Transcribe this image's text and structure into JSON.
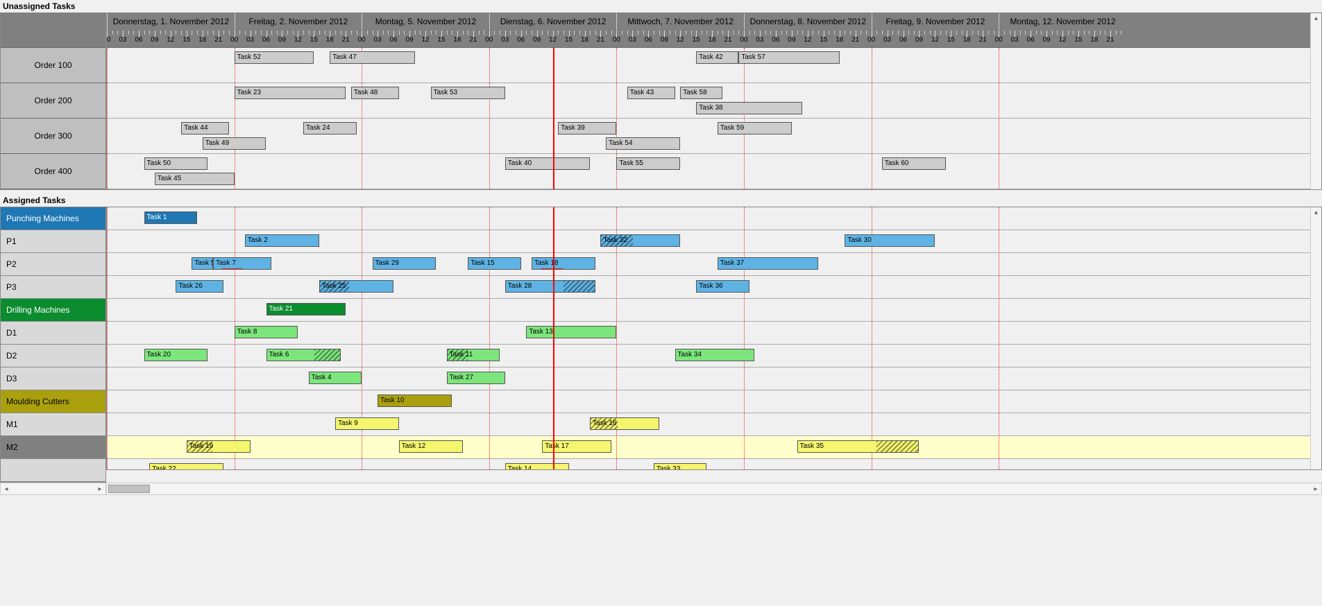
{
  "sections": {
    "unassigned": "Unassigned Tasks",
    "assigned": "Assigned Tasks"
  },
  "timeline": {
    "days": [
      "Donnerstag, 1. November 2012",
      "Freitag, 2. November 2012",
      "Montag, 5. November 2012",
      "Dienstag, 6. November 2012",
      "Mittwoch, 7. November 2012",
      "Donnerstag, 8. November 2012",
      "Freitag, 9. November 2012",
      "Montag, 12. November 2012"
    ],
    "dayStarts": [
      0,
      24,
      48,
      72,
      96,
      120,
      144,
      168
    ],
    "hours": [
      "00",
      "03",
      "06",
      "09",
      "12",
      "15",
      "18",
      "21"
    ],
    "nowHour": 84,
    "pxPerHour": 7.65
  },
  "orders": [
    "Order 100",
    "Order 200",
    "Order 300",
    "Order 400"
  ],
  "unassignedTasks": [
    {
      "row": 0,
      "sub": 0,
      "label": "Task 52",
      "start": 24,
      "dur": 15
    },
    {
      "row": 0,
      "sub": 0,
      "label": "Task 47",
      "start": 42,
      "dur": 16
    },
    {
      "row": 0,
      "sub": 0,
      "label": "Task 42",
      "start": 111,
      "dur": 8
    },
    {
      "row": 0,
      "sub": 0,
      "label": "Task 57",
      "start": 119,
      "dur": 19
    },
    {
      "row": 1,
      "sub": 0,
      "label": "Task 23",
      "start": 24,
      "dur": 21
    },
    {
      "row": 1,
      "sub": 0,
      "label": "Task 48",
      "start": 46,
      "dur": 9
    },
    {
      "row": 1,
      "sub": 0,
      "label": "Task 53",
      "start": 61,
      "dur": 14
    },
    {
      "row": 1,
      "sub": 0,
      "label": "Task 43",
      "start": 98,
      "dur": 9
    },
    {
      "row": 1,
      "sub": 0,
      "label": "Task 58",
      "start": 108,
      "dur": 8
    },
    {
      "row": 1,
      "sub": 1,
      "label": "Task 38",
      "start": 111,
      "dur": 20
    },
    {
      "row": 2,
      "sub": 0,
      "label": "Task 44",
      "start": 14,
      "dur": 9
    },
    {
      "row": 2,
      "sub": 0,
      "label": "Task 24",
      "start": 37,
      "dur": 10
    },
    {
      "row": 2,
      "sub": 0,
      "label": "Task 39",
      "start": 85,
      "dur": 11
    },
    {
      "row": 2,
      "sub": 0,
      "label": "Task 59",
      "start": 115,
      "dur": 14
    },
    {
      "row": 2,
      "sub": 1,
      "label": "Task 49",
      "start": 18,
      "dur": 12
    },
    {
      "row": 2,
      "sub": 1,
      "label": "Task 54",
      "start": 94,
      "dur": 14
    },
    {
      "row": 3,
      "sub": 0,
      "label": "Task 50",
      "start": 7,
      "dur": 12
    },
    {
      "row": 3,
      "sub": 0,
      "label": "Task 40",
      "start": 75,
      "dur": 16
    },
    {
      "row": 3,
      "sub": 0,
      "label": "Task 55",
      "start": 96,
      "dur": 12
    },
    {
      "row": 3,
      "sub": 0,
      "label": "Task 60",
      "start": 146,
      "dur": 12
    },
    {
      "row": 3,
      "sub": 1,
      "label": "Task 45",
      "start": 9,
      "dur": 15
    }
  ],
  "resources": [
    {
      "label": "Punching Machines",
      "type": "group",
      "cls": "group-punching"
    },
    {
      "label": "P1",
      "type": "res",
      "cls": "resource"
    },
    {
      "label": "P2",
      "type": "res",
      "cls": "resource"
    },
    {
      "label": "P3",
      "type": "res",
      "cls": "resource"
    },
    {
      "label": "Drilling Machines",
      "type": "group",
      "cls": "group-drilling"
    },
    {
      "label": "D1",
      "type": "res",
      "cls": "resource"
    },
    {
      "label": "D2",
      "type": "res",
      "cls": "resource"
    },
    {
      "label": "D3",
      "type": "res",
      "cls": "resource"
    },
    {
      "label": "Moulding Cutters",
      "type": "group",
      "cls": "group-moulding"
    },
    {
      "label": "M1",
      "type": "res",
      "cls": "resource"
    },
    {
      "label": "M2",
      "type": "res",
      "cls": "resource sel",
      "highlight": true
    },
    {
      "label": "",
      "type": "res",
      "cls": "resource"
    }
  ],
  "assignedTasks": [
    {
      "row": 0,
      "label": "Task 1",
      "start": 7,
      "dur": 10,
      "cls": "c-punch-dark"
    },
    {
      "row": 1,
      "label": "Task 2",
      "start": 26,
      "dur": 14,
      "cls": "c-punch"
    },
    {
      "row": 1,
      "label": "Task 32",
      "start": 93,
      "dur": 15,
      "cls": "c-punch hatch"
    },
    {
      "row": 1,
      "label": "Task 30",
      "start": 139,
      "dur": 17,
      "cls": "c-punch"
    },
    {
      "row": 2,
      "label": "Task 5",
      "start": 16,
      "dur": 4,
      "cls": "c-punch"
    },
    {
      "row": 2,
      "label": "Task 7",
      "start": 20,
      "dur": 11,
      "cls": "c-punch redmark"
    },
    {
      "row": 2,
      "label": "Task 29",
      "start": 50,
      "dur": 12,
      "cls": "c-punch"
    },
    {
      "row": 2,
      "label": "Task 15",
      "start": 68,
      "dur": 10,
      "cls": "c-punch"
    },
    {
      "row": 2,
      "label": "Task 18",
      "start": 80,
      "dur": 12,
      "cls": "c-punch redmark"
    },
    {
      "row": 2,
      "label": "Task 37",
      "start": 115,
      "dur": 19,
      "cls": "c-punch"
    },
    {
      "row": 3,
      "label": "Task 26",
      "start": 13,
      "dur": 9,
      "cls": "c-punch"
    },
    {
      "row": 3,
      "label": "Task 25",
      "start": 40,
      "dur": 14,
      "cls": "c-punch hatch"
    },
    {
      "row": 3,
      "label": "Task 28",
      "start": 75,
      "dur": 17,
      "cls": "c-punch hatch-r"
    },
    {
      "row": 3,
      "label": "Task 36",
      "start": 111,
      "dur": 10,
      "cls": "c-punch"
    },
    {
      "row": 4,
      "label": "Task 21",
      "start": 30,
      "dur": 15,
      "cls": "c-drill-dark"
    },
    {
      "row": 5,
      "label": "Task 8",
      "start": 24,
      "dur": 12,
      "cls": "c-drill"
    },
    {
      "row": 5,
      "label": "Task 13",
      "start": 79,
      "dur": 17,
      "cls": "c-drill"
    },
    {
      "row": 6,
      "label": "Task 20",
      "start": 7,
      "dur": 12,
      "cls": "c-drill"
    },
    {
      "row": 6,
      "label": "Task 6",
      "start": 30,
      "dur": 14,
      "cls": "c-drill hatch-r"
    },
    {
      "row": 6,
      "label": "Task 11",
      "start": 64,
      "dur": 10,
      "cls": "c-drill hatch"
    },
    {
      "row": 6,
      "label": "Task 34",
      "start": 107,
      "dur": 15,
      "cls": "c-drill"
    },
    {
      "row": 7,
      "label": "Task 4",
      "start": 38,
      "dur": 10,
      "cls": "c-drill"
    },
    {
      "row": 7,
      "label": "Task 27",
      "start": 64,
      "dur": 11,
      "cls": "c-drill"
    },
    {
      "row": 8,
      "label": "Task 10",
      "start": 51,
      "dur": 14,
      "cls": "c-mould-dark"
    },
    {
      "row": 9,
      "label": "Task 9",
      "start": 43,
      "dur": 12,
      "cls": "c-mould"
    },
    {
      "row": 9,
      "label": "Task 16",
      "start": 91,
      "dur": 13,
      "cls": "c-mould hatch"
    },
    {
      "row": 10,
      "label": "Task 19",
      "start": 15,
      "dur": 12,
      "cls": "c-mould hatch"
    },
    {
      "row": 10,
      "label": "Task 12",
      "start": 55,
      "dur": 12,
      "cls": "c-mould"
    },
    {
      "row": 10,
      "label": "Task 17",
      "start": 82,
      "dur": 13,
      "cls": "c-mould"
    },
    {
      "row": 10,
      "label": "Task 35",
      "start": 130,
      "dur": 23,
      "cls": "c-mould hatch-r"
    },
    {
      "row": 11,
      "label": "Task 22",
      "start": 8,
      "dur": 14,
      "cls": "c-mould"
    },
    {
      "row": 11,
      "label": "Task 14",
      "start": 75,
      "dur": 12,
      "cls": "c-mould"
    },
    {
      "row": 11,
      "label": "Task 33",
      "start": 103,
      "dur": 10,
      "cls": "c-mould"
    }
  ]
}
